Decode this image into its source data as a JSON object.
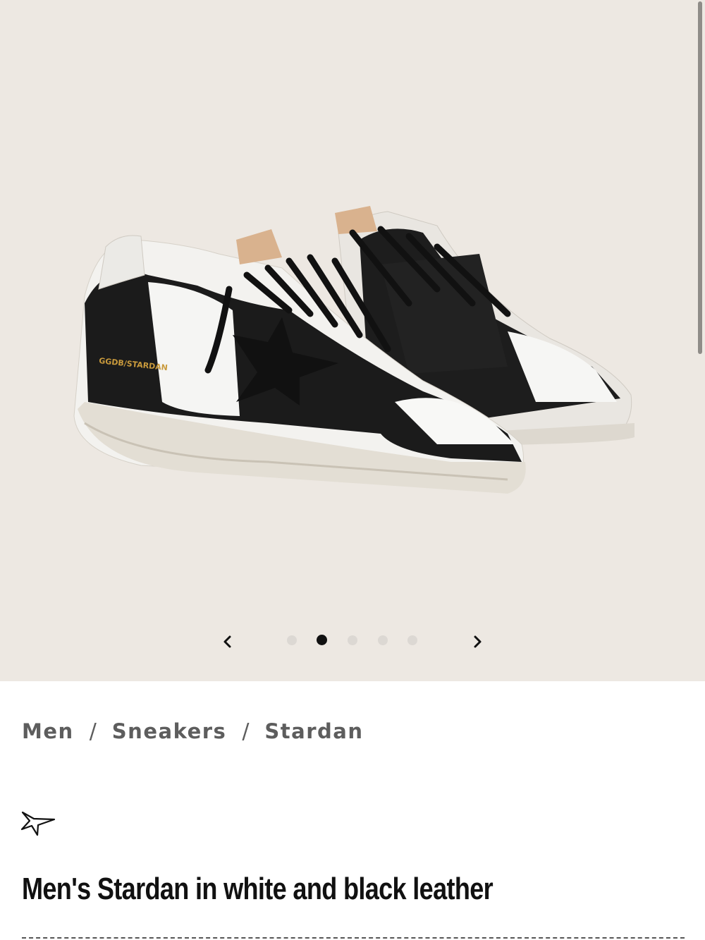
{
  "gallery": {
    "image_alt": "Stardan sneakers in white and black leather",
    "shoe_print": "GGDB/STARDAN",
    "slide_count": 5,
    "active_slide": 2,
    "prev_label": "‹",
    "next_label": "›"
  },
  "breadcrumb": {
    "items": [
      "Men",
      "Sneakers",
      "Stardan"
    ],
    "separator": "/"
  },
  "product": {
    "title": "Men's Stardan in white and black leather",
    "wishlist_icon": "star-outline-icon"
  },
  "colors": {
    "gallery_bg": "#ede8e2",
    "text_dark": "#111111",
    "breadcrumb": "#5d5d5d"
  }
}
